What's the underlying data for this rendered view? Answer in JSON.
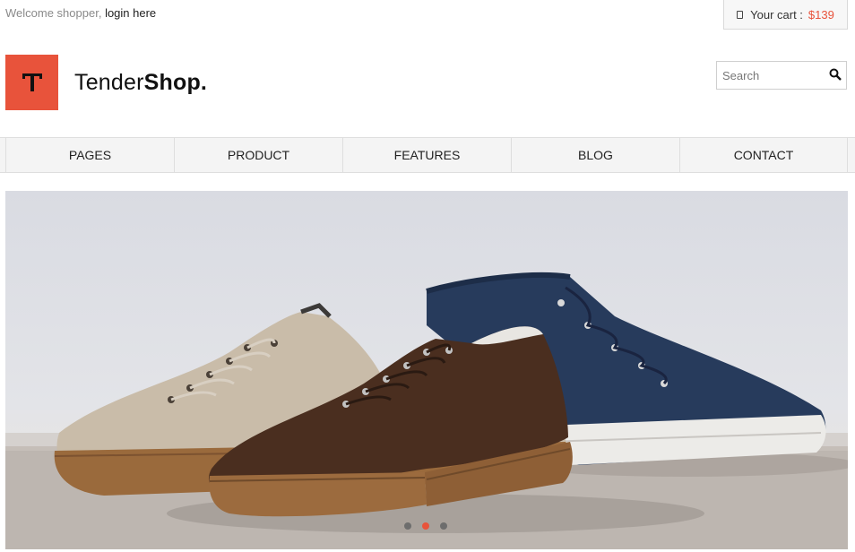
{
  "topbar": {
    "welcome_text": "Welcome shopper,",
    "login_link": "login here",
    "cart_label": "Your cart :",
    "cart_total": "$139"
  },
  "brand": {
    "name_regular": "Tender",
    "name_bold": "Shop."
  },
  "search": {
    "placeholder": "Search"
  },
  "nav": {
    "items": [
      {
        "label": "PAGES"
      },
      {
        "label": "PRODUCT"
      },
      {
        "label": "FEATURES"
      },
      {
        "label": "BLOG"
      },
      {
        "label": "CONTACT"
      }
    ]
  },
  "slider": {
    "slide_count": 3,
    "active_index": 1
  },
  "colors": {
    "accent": "#e8533b",
    "nav_bg": "#f4f4f4"
  },
  "icons": {
    "cart": "cart-icon",
    "search": "search-icon",
    "logo": "logo-t-icon"
  }
}
